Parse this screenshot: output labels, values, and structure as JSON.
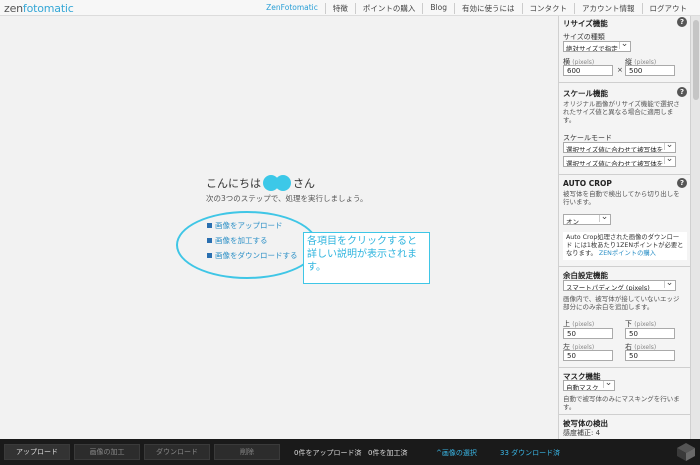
{
  "topbar": {
    "logo_prefix": "zen",
    "logo_suffix": "fotomatic",
    "nav": [
      "ZenFotomatic",
      "特徴",
      "ポイントの購入",
      "Blog",
      "有効に使うには",
      "コンタクト",
      "アカウント情報",
      "ログアウト"
    ]
  },
  "main": {
    "greeting_before": "こんにちは",
    "greeting_after": "さん",
    "subtitle": "次の3つのステップで、処理を実行しましょう。",
    "steps": [
      "画像をアップロード",
      "画像を加工する",
      "画像をダウンロードする"
    ],
    "tip": "各項目をクリックすると詳しい説明が表示されます。"
  },
  "panel": {
    "resize": {
      "title": "リサイズ機能",
      "type_label": "サイズの種類",
      "type_value": "絶対サイズで指定",
      "width_label": "横",
      "height_label": "縦",
      "unit": "(pixels)",
      "width_value": "600",
      "times": "×",
      "height_value": "500"
    },
    "scale": {
      "title": "スケール機能",
      "desc": "オリジナル画像がリサイズ機能で選択されたサイズ値と異なる場合に適用します。",
      "mode_label": "スケールモード",
      "mode1": "選択サイズ値に合わせて被写体を",
      "mode2": "選択サイズ値に合わせて被写体を"
    },
    "autocrop": {
      "title": "AUTO CROP",
      "desc": "被写体を自動で検出してから切り出しを行います。",
      "value": "オン",
      "note": "Auto Crop処理された画像のダウンロード には1枚あたり1ZENポイントが必要となります。",
      "note_link": "ZENポイントの購入"
    },
    "margin": {
      "title": "余白設定機能",
      "mode": "スマートパディング (pixels)",
      "desc": "画像内で、被写体が接していないエッジ部分にのみ余白を追加します。",
      "top_label": "上",
      "bottom_label": "下",
      "left_label": "左",
      "right_label": "右",
      "unit": "(pixels)",
      "top": "50",
      "bottom": "50",
      "left": "50",
      "right": "50"
    },
    "mask": {
      "title": "マスク機能",
      "value": "自動マスク",
      "desc": "自動で被写体のみにマスキングを行います。"
    },
    "detect": {
      "title": "被写体の検出",
      "sensitivity": "感度補正: 4"
    }
  },
  "bottombar": {
    "buttons": [
      "アップロード",
      "画像の加工",
      "ダウンロード",
      "削除"
    ],
    "uploaded": "0件をアップロード済",
    "processed": "0件を加工済",
    "select_images": "^画像の選択",
    "downloaded": "33 ダウンロード済"
  },
  "colors": {
    "accent": "#3fc6e6",
    "link": "#2a8fc6",
    "bottom_bg": "#1a1a1a"
  }
}
